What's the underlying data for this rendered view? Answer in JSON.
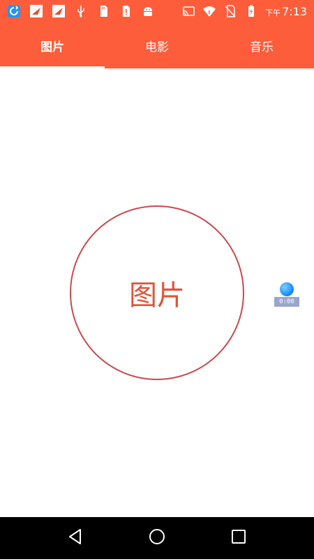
{
  "status_bar": {
    "icons_left": [
      "sync-icon",
      "bird-app-icon",
      "bird-app-icon-2",
      "usb-icon",
      "sd-card-icon",
      "sd-card-alert-icon",
      "android-icon"
    ],
    "icons_right": [
      "cast-icon",
      "wifi-icon",
      "no-sim-icon",
      "battery-charging-icon"
    ],
    "time_ampm": "下午",
    "time": "7:13"
  },
  "tabs": [
    {
      "label": "图片",
      "active": true
    },
    {
      "label": "电影",
      "active": false
    },
    {
      "label": "音乐",
      "active": false
    }
  ],
  "main": {
    "circle_label": "图片"
  },
  "floating_widget": {
    "label": "0:00"
  },
  "nav_bar": {
    "buttons": [
      "back-icon",
      "home-icon",
      "recents-icon"
    ]
  },
  "colors": {
    "accent": "#fe5d3b",
    "circle_border": "#c84a4f",
    "circle_text": "#e0543a"
  }
}
